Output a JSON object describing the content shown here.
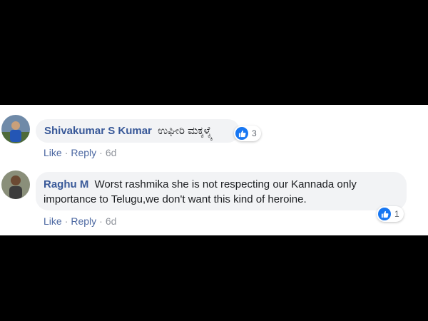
{
  "colors": {
    "name": "#385898",
    "bubble_bg": "#f2f3f5",
    "action_link": "#4b67a1",
    "like_blue": "#1877f2"
  },
  "comments": [
    {
      "author": "Shivakumar S Kumar",
      "text": "ಉಘೀರಿ ಮಕ್ಕಳ್ಕ್ಕೆ",
      "reaction_count": "3",
      "actions": {
        "like": "Like",
        "reply": "Reply",
        "time": "6d",
        "sep": "·"
      }
    },
    {
      "author": "Raghu M",
      "text_line1": "Worst rashmika she is not respecting our Kannada only",
      "text_line2": "importance to Telugu,we don't want this kind of heroine.",
      "reaction_count": "1",
      "actions": {
        "like": "Like",
        "reply": "Reply",
        "time": "6d",
        "sep": "·"
      }
    }
  ]
}
